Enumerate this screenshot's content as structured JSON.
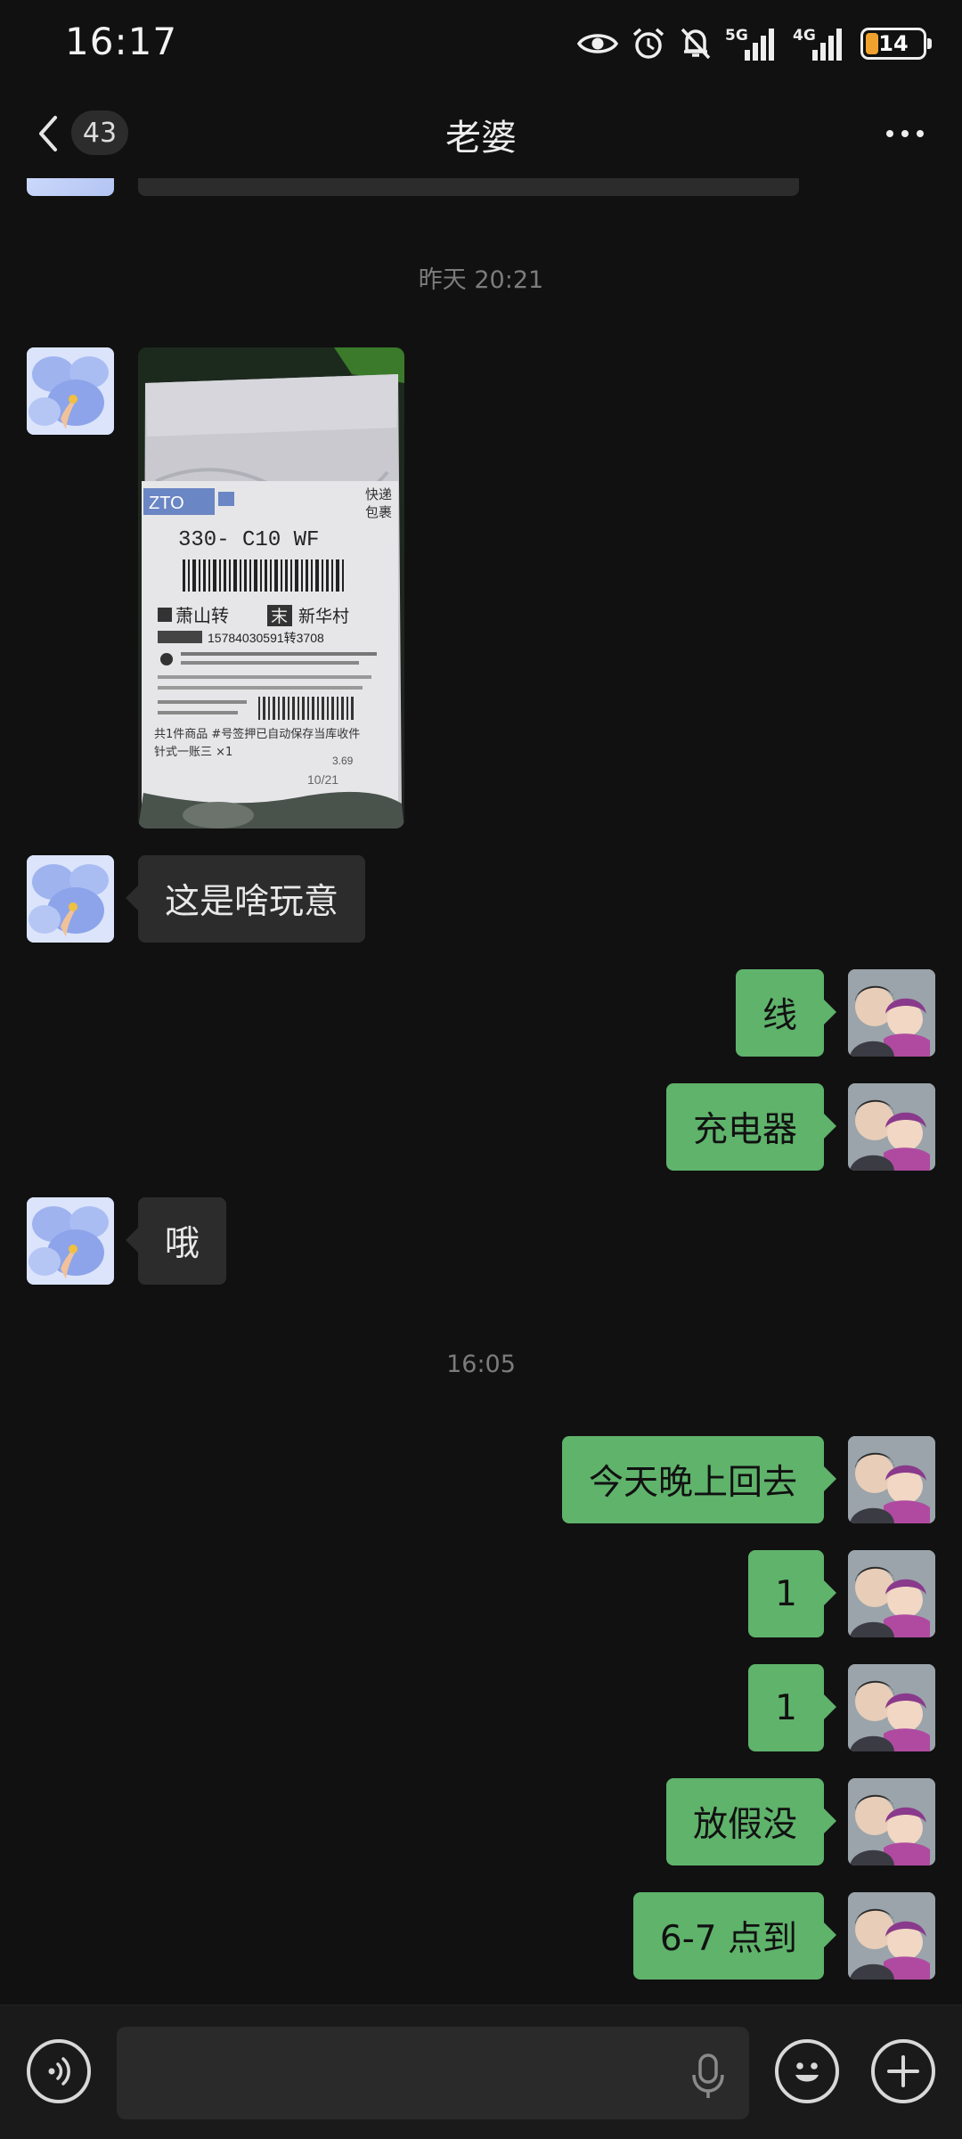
{
  "status_bar": {
    "time": "16:17",
    "net1": "5G",
    "net2": "4G",
    "battery": "14",
    "battery_color": "#f0a22e"
  },
  "header": {
    "unread_count": "43",
    "title": "老婆"
  },
  "messages": {
    "ts1": "昨天 20:21",
    "m1": "这是啥玩意",
    "m2": "线",
    "m3": "充电器",
    "m4": "哦",
    "ts2": "16:05",
    "m5": "今天晚上回去",
    "m6": "1",
    "m7": "1",
    "m8": "放假没",
    "m9": "6-7 点到"
  },
  "package_label": {
    "brand": "ZTO",
    "tag1": "快递",
    "tag2": "包裹",
    "code": "330- C10 WF",
    "dest1": "萧山转",
    "dest_mid": "末",
    "dest2": "新华村",
    "phone": "15784030591转3708",
    "footer": "共1件商品 #号签押已自动保存当库收件",
    "footer2": "针式一账三 ×1",
    "weight": "3.69",
    "date": "10/21"
  },
  "colors": {
    "background": "#111111",
    "bubble_mine": "#5fb36b",
    "bubble_other": "#2c2c2c"
  }
}
